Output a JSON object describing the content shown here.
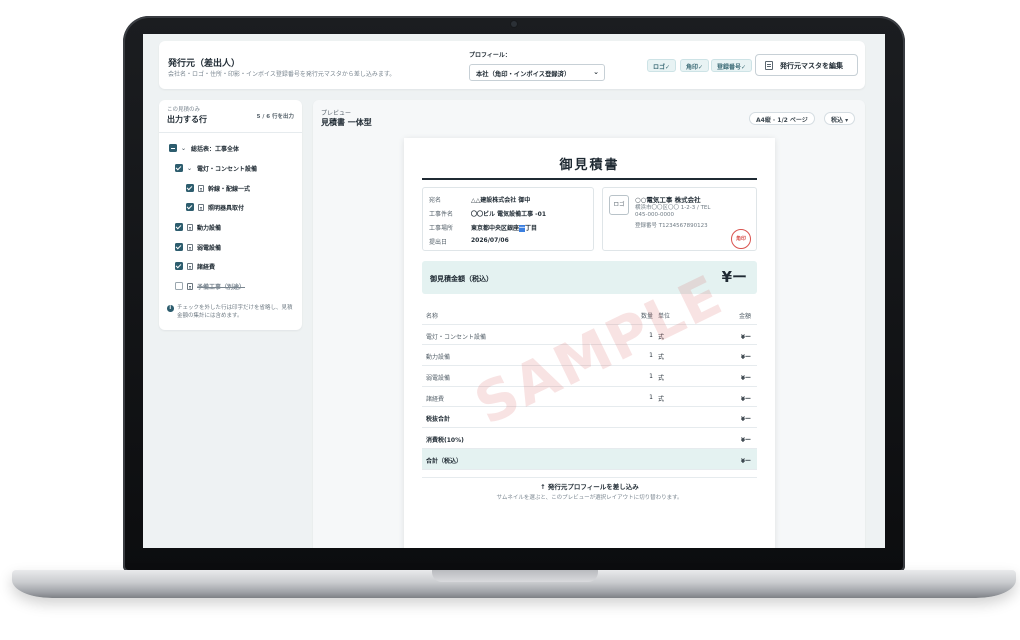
{
  "header": {
    "issuer_title": "発行元（差出人）",
    "issuer_desc": "会社名・ロゴ・住所・印影・インボイス登録番号を発行元マスタから差し込みます。",
    "profile_label": "プロフィール：",
    "profile_value": "本社（角印・インボイス登録済）",
    "chips": [
      "ロゴ✓",
      "角印✓",
      "登録番号✓"
    ],
    "edit_button": "発行元マスタを編集"
  },
  "left_panel": {
    "subtitle": "この見積のみ",
    "title": "出力する行",
    "count": "5 / 6 行を出力",
    "items": [
      {
        "label": "総括表：工事全体",
        "state": "partial",
        "chevron": "⌄"
      },
      {
        "label": "電灯・コンセント設備",
        "state": "checked",
        "chevron": "⌄"
      },
      {
        "label": "幹線・配線一式",
        "state": "checked"
      },
      {
        "label": "照明器具取付",
        "state": "checked"
      },
      {
        "label": "動力設備",
        "state": "checked"
      },
      {
        "label": "弱電設備",
        "state": "checked"
      },
      {
        "label": "諸経費",
        "state": "checked"
      },
      {
        "label": "予備工事（別途）",
        "state": "unchecked"
      }
    ],
    "note": "チェックを外した行は印字だけを省略し、見積金額の集計には含めます。"
  },
  "preview": {
    "subtitle": "プレビュー",
    "title": "見積書 一体型",
    "page_pill": "A4縦 · 1/2 ページ",
    "tax_pill": "税込 ▾",
    "doc": {
      "title": "御見積書",
      "fields": [
        {
          "key": "宛名",
          "value": "△△建設株式会社 御中"
        },
        {
          "key": "工事件名",
          "value": "〇〇ビル 電気設備工事 -01"
        },
        {
          "key": "工事場所",
          "value_pre": "東京都中央区銀座",
          "value_hl": "一",
          "value_post": "丁目"
        },
        {
          "key": "提出日",
          "value": "2026/07/06"
        }
      ],
      "logo_placeholder": "ロゴ",
      "issuer": {
        "name": "○○電気工事 株式会社",
        "address": "横浜市〇〇区〇〇 1-2-3 / TEL",
        "tel": "045-000-0000",
        "reg": "登録番号 T1234567890123"
      },
      "seal": "角印",
      "total_label": "御見積金額（税込）",
      "total_value": "¥ー",
      "table": {
        "headers": {
          "name": "名称",
          "qty": "数量",
          "unit": "単位",
          "amount": "金額"
        },
        "rows": [
          {
            "name": "電灯・コンセント設備",
            "qty": "1",
            "unit": "式",
            "amount": "¥ー"
          },
          {
            "name": "動力設備",
            "qty": "1",
            "unit": "式",
            "amount": "¥ー"
          },
          {
            "name": "弱電設備",
            "qty": "1",
            "unit": "式",
            "amount": "¥ー"
          },
          {
            "name": "諸経費",
            "qty": "1",
            "unit": "式",
            "amount": "¥ー"
          }
        ],
        "subtotal": {
          "name": "税抜合計",
          "amount": "¥ー"
        },
        "tax": {
          "name": "消費税(10%)",
          "amount": "¥ー"
        },
        "grand": {
          "name": "合計（税込）",
          "amount": "¥ー"
        }
      },
      "insert_title": "↑ 発行元プロフィールを差し込み",
      "insert_desc": "サムネイルを選ぶと、このプレビューが選択レイアウトに切り替わります。",
      "watermark": "SAMPLE"
    }
  },
  "colors": {
    "accent": "#2d5d6e",
    "band": "#e4f2f1",
    "seal": "#d9534f"
  }
}
